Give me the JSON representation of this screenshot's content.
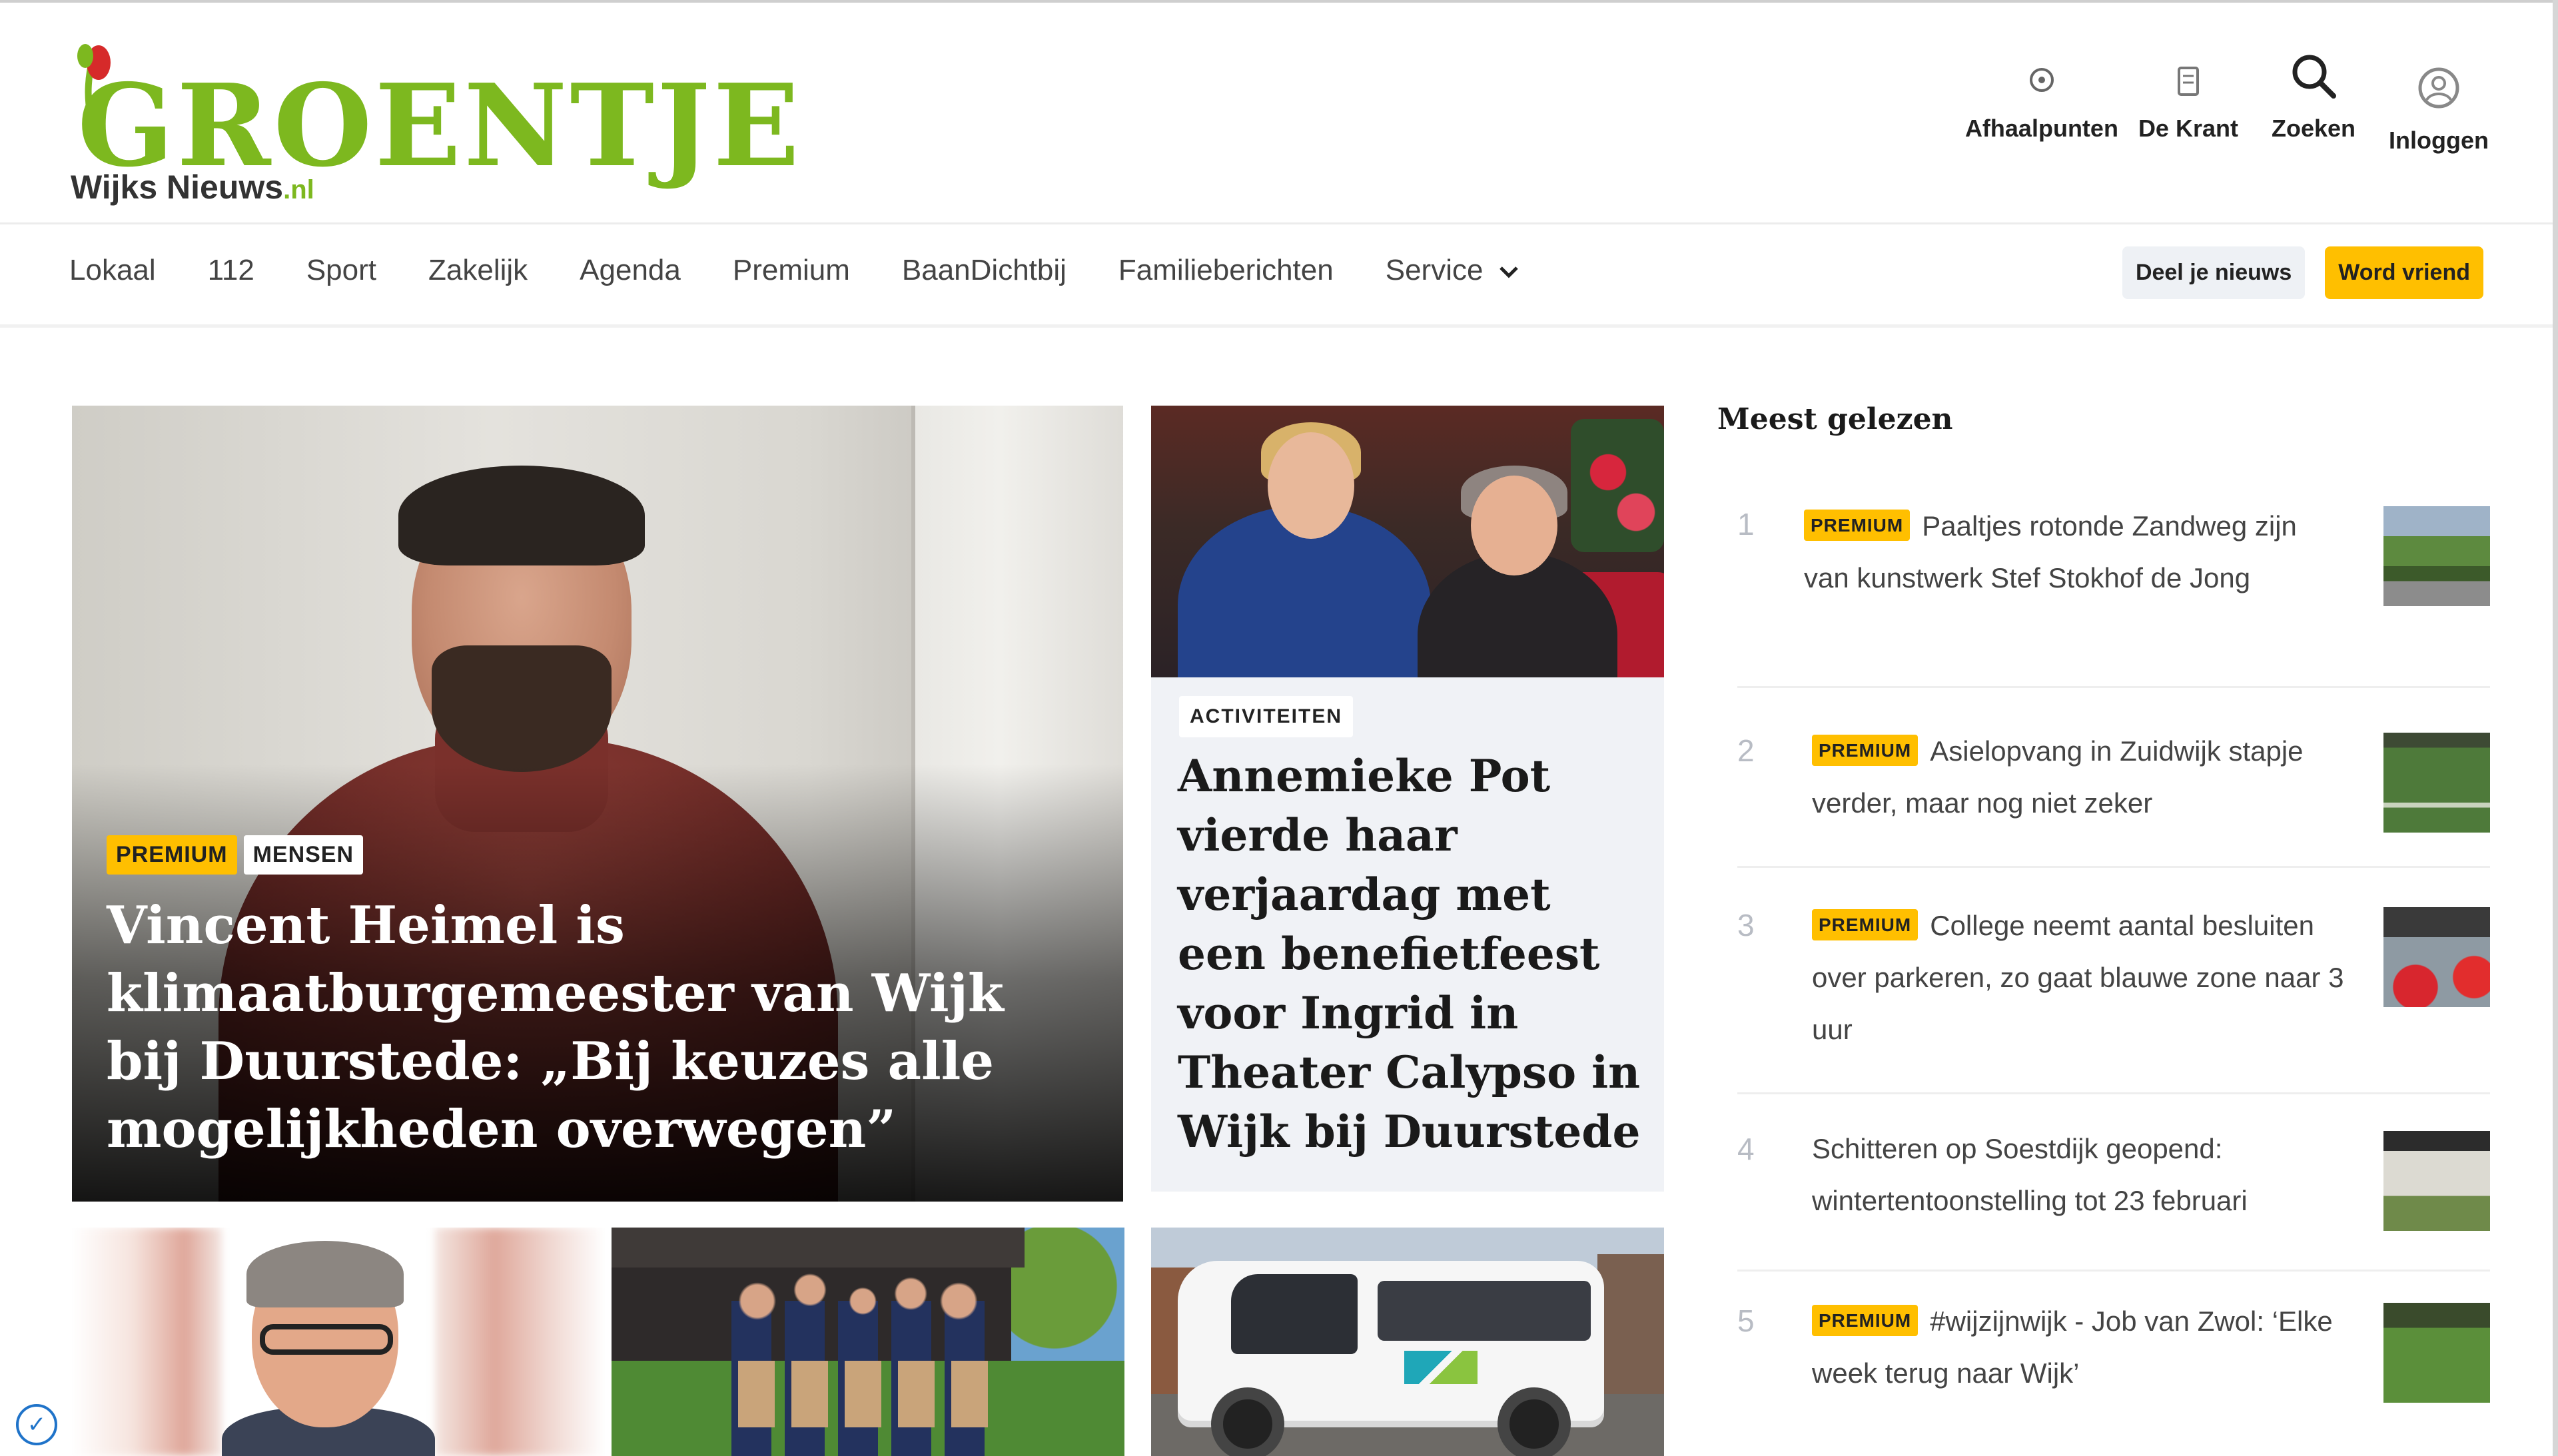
{
  "brand": {
    "logo_word": "GROENTJE",
    "logo_sub": "Wijks Nieuws",
    "logo_tld": ".nl",
    "accent": "#7db81f"
  },
  "header_actions": [
    {
      "label": "Afhaalpunten",
      "icon": "location-pin-icon"
    },
    {
      "label": "De Krant",
      "icon": "newspaper-icon"
    },
    {
      "label": "Zoeken",
      "icon": "search-icon"
    },
    {
      "label": "Inloggen",
      "icon": "user-icon"
    }
  ],
  "nav": {
    "items": [
      "Lokaal",
      "112",
      "Sport",
      "Zakelijk",
      "Agenda",
      "Premium",
      "BaanDichtbij",
      "Familieberichten",
      "Service"
    ],
    "share_button": "Deel je nieuws",
    "friend_button": "Word vriend"
  },
  "feature": {
    "tag_premium": "PREMIUM",
    "tag_category": "MENSEN",
    "title": "Vincent Heimel is klimaatburgemeester van Wijk bij Duurstede: „Bij keuzes alle mogelijkheden overwegen”"
  },
  "second": {
    "tag": "ACTIVITEITEN",
    "title": "Annemieke Pot vierde haar verjaardag met een benefietfeest voor Ingrid in Theater Calypso in Wijk bij Duurstede"
  },
  "sidebar": {
    "title": "Meest gelezen",
    "items": [
      {
        "num": "1",
        "premium": "PREMIUM",
        "text": "Paaltjes rotonde Zandweg zijn van kunstwerk Stef Stokhof de Jong"
      },
      {
        "num": "2",
        "premium": "PREMIUM",
        "text": "Asielopvang in Zuidwijk stapje verder, maar nog niet zeker"
      },
      {
        "num": "3",
        "premium": "PREMIUM",
        "text": "College neemt aantal besluiten over parkeren, zo gaat blauwe zone naar 3 uur"
      },
      {
        "num": "4",
        "premium": "",
        "text": "Schitteren op Soestdijk geopend: wintertentoonstelling tot 23 februari"
      },
      {
        "num": "5",
        "premium": "PREMIUM",
        "text": "#wijzijnwijk - Job van Zwol: ‘Elke week terug naar Wijk’"
      }
    ]
  },
  "colors": {
    "premium": "#ffbf00",
    "tag_bg": "#ffffff",
    "second_bg": "#f0f2f6"
  }
}
